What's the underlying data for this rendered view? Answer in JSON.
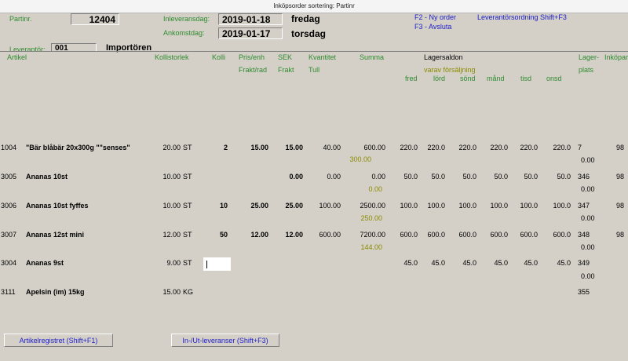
{
  "window": {
    "title": "Inköpsorder sortering: Partinr"
  },
  "header": {
    "partinr_label": "Partinr.",
    "partinr_value": "12404",
    "inleveransdag_label": "Inleveransdag:",
    "inleveransdag_value": "2019-01-18",
    "inleveransdag_weekday": "fredag",
    "ankomstdag_label": "Ankomstdag:",
    "ankomstdag_value": "2019-01-17",
    "ankomstdag_weekday": "torsdag",
    "f2_label": "F2 - Ny order",
    "f3_label": "F3 - Avsluta",
    "sort_label": "Leverantörsordning Shift+F3",
    "leverantor_label": "Leverantör:",
    "leverantor_value": "001",
    "leverantor_name": "Importören"
  },
  "columns": {
    "artikel": "Artikel",
    "kollistorlek": "Kollistorlek",
    "kolli": "Kolli",
    "prisenh": "Pris/enh",
    "fraktrad": "Frakt/rad",
    "sek": "SEK",
    "frakt": "Frakt",
    "kvantitet": "Kvantitet",
    "tull": "Tull",
    "summa": "Summa",
    "lagersaldon": "Lagersaldon",
    "varav": "varav försäljning",
    "fred": "fred",
    "lord": "lörd",
    "sond": "sönd",
    "mand": "månd",
    "tisd": "tisd",
    "onsd": "onsd",
    "lager": "Lager-",
    "plats": "plats",
    "inkopare": "Inköpare"
  },
  "rows": [
    {
      "artnr": "1004",
      "name": "\"Bär blåbär 20x300g \"\"senses\"",
      "size": "20.00",
      "unit": "ST",
      "kolli": "2",
      "pris": "15.00",
      "sek": "15.00",
      "kvant": "40.00",
      "summa": "600.00",
      "frakt": "300.00",
      "fred": "220.0",
      "lord": "220.0",
      "sond": "220.0",
      "mand": "220.0",
      "tisd": "220.0",
      "onsd": "220.0",
      "plats": "7",
      "plats2": "0.00",
      "ink": "98"
    },
    {
      "artnr": "3005",
      "name": "Ananas 10st",
      "size": "10.00",
      "unit": "ST",
      "kolli": "",
      "pris": "",
      "sek": "0.00",
      "kvant": "0.00",
      "summa": "0.00",
      "frakt": "0.00",
      "fred": "50.0",
      "lord": "50.0",
      "sond": "50.0",
      "mand": "50.0",
      "tisd": "50.0",
      "onsd": "50.0",
      "plats": "346",
      "plats2": "0.00",
      "ink": "98"
    },
    {
      "artnr": "3006",
      "name": "Ananas 10st fyffes",
      "size": "10.00",
      "unit": "ST",
      "kolli": "10",
      "pris": "25.00",
      "sek": "25.00",
      "kvant": "100.00",
      "summa": "2500.00",
      "frakt": "250.00",
      "fred": "100.0",
      "lord": "100.0",
      "sond": "100.0",
      "mand": "100.0",
      "tisd": "100.0",
      "onsd": "100.0",
      "plats": "347",
      "plats2": "0.00",
      "ink": "98"
    },
    {
      "artnr": "3007",
      "name": "Ananas 12st  mini",
      "size": "12.00",
      "unit": "ST",
      "kolli": "50",
      "pris": "12.00",
      "sek": "12.00",
      "kvant": "600.00",
      "summa": "7200.00",
      "frakt": "144.00",
      "fred": "600.0",
      "lord": "600.0",
      "sond": "600.0",
      "mand": "600.0",
      "tisd": "600.0",
      "onsd": "600.0",
      "plats": "348",
      "plats2": "0.00",
      "ink": "98"
    },
    {
      "artnr": "3004",
      "name": "Ananas 9st",
      "size": "9.00",
      "unit": "ST",
      "kolli": "",
      "pris": "",
      "sek": "",
      "kvant": "",
      "summa": "",
      "frakt": "",
      "fred": "45.0",
      "lord": "45.0",
      "sond": "45.0",
      "mand": "45.0",
      "tisd": "45.0",
      "onsd": "45.0",
      "plats": "349",
      "plats2": "0.00",
      "ink": ""
    },
    {
      "artnr": "3111",
      "name": "Apelsin (im)  15kg",
      "size": "15.00",
      "unit": "KG",
      "kolli": "",
      "pris": "",
      "sek": "",
      "kvant": "",
      "summa": "",
      "frakt": "",
      "fred": "",
      "lord": "",
      "sond": "",
      "mand": "",
      "tisd": "",
      "onsd": "",
      "plats": "355",
      "plats2": "",
      "ink": ""
    }
  ],
  "footer": {
    "artikelregistret": "Artikelregistret (Shift+F1)",
    "inut": "In-/Ut-leveranser (Shift+F3)"
  }
}
